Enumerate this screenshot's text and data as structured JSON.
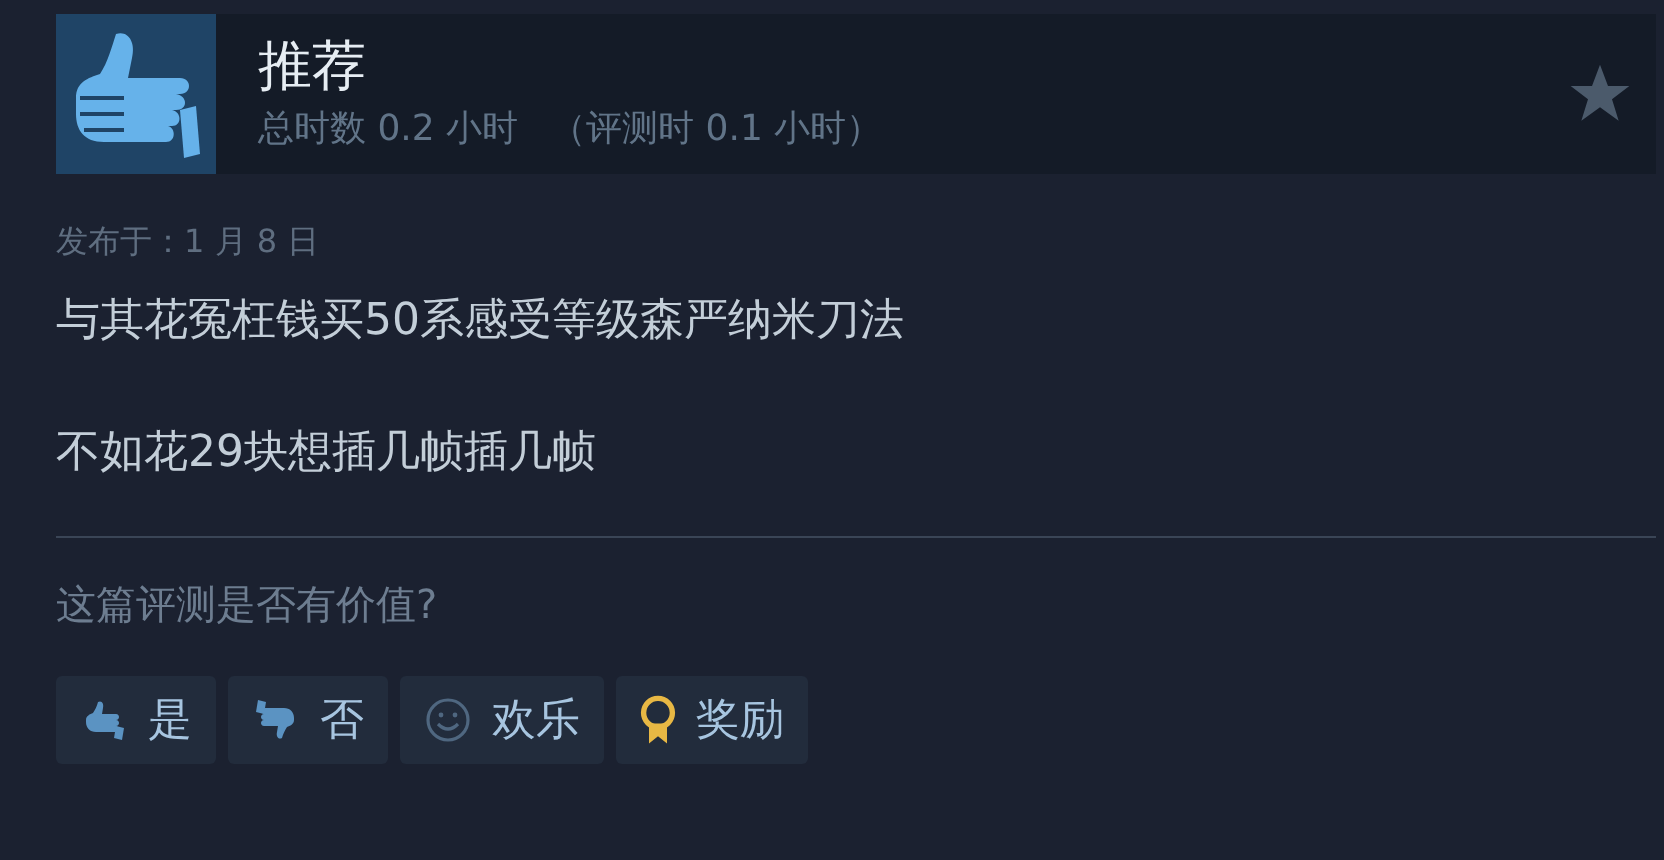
{
  "review": {
    "verdict": "推荐",
    "kind": "recommended",
    "playtime": "总时数 0.2 小时",
    "review_time": "（评测时 0.1 小时）",
    "posted": "发布于：1 月 8 日",
    "paragraphs": [
      "与其花冤枉钱买50系感受等级森严纳米刀法",
      "不如花29块想插几帧插几帧"
    ]
  },
  "feedback": {
    "question": "这篇评测是否有价值?",
    "buttons": [
      {
        "label": "是",
        "kind": "yes"
      },
      {
        "label": "否",
        "kind": "no"
      },
      {
        "label": "欢乐",
        "kind": "funny"
      },
      {
        "label": "奖励",
        "kind": "award"
      }
    ]
  }
}
